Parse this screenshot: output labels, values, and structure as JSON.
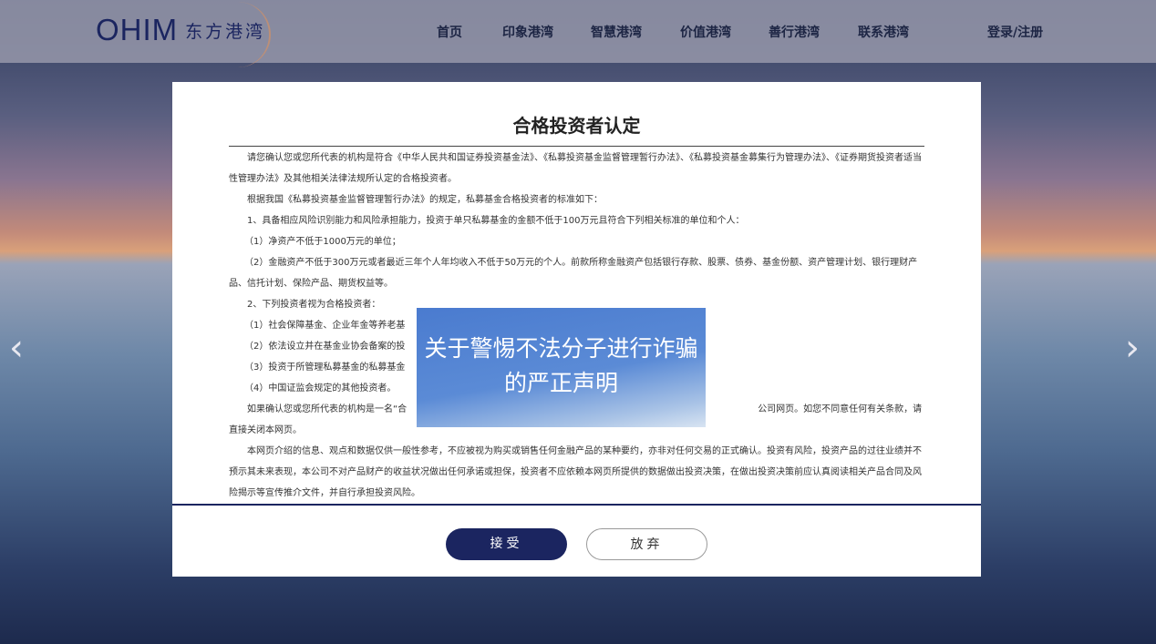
{
  "header": {
    "logo_en": "OHIM",
    "logo_cn": "东方港湾",
    "nav": [
      "首页",
      "印象港湾",
      "智慧港湾",
      "价值港湾",
      "善行港湾",
      "联系港湾"
    ],
    "login": "登录/注册"
  },
  "carousel": {
    "prev": "‹",
    "next": "›"
  },
  "modal": {
    "title": "合格投资者认定",
    "paragraphs": [
      "请您确认您或您所代表的机构是符合《中华人民共和国证券投资基金法》、《私募投资基金监督管理暂行办法》、《私募投资基金募集行为管理办法》、《证券期货投资者适当性管理办法》及其他相关法律法规所认定的合格投资者。",
      "根据我国《私募投资基金监督管理暂行办法》的规定，私募基金合格投资者的标准如下：",
      "1、具备相应风险识别能力和风险承担能力，投资于单只私募基金的金额不低于100万元且符合下列相关标准的单位和个人：",
      "（1）净资产不低于1000万元的单位；",
      "（2）金融资产不低于300万元或者最近三年个人年均收入不低于50万元的个人。前款所称金融资产包括银行存款、股票、债券、基金份额、资产管理计划、银行理财产品、信托计划、保险产品、期货权益等。",
      "2、下列投资者视为合格投资者：",
      "（1）社会保障基金、企业年金等养老基",
      "（2）依法设立并在基金业协会备案的投",
      "（3）投资于所管理私募基金的私募基金",
      "（4）中国证监会规定的其他投资者。",
      "如果确认您或您所代表的机构是一名“合",
      "公司网页。如您不同意任何有关条款，请直接关闭本网页。",
      "本网页介绍的信息、观点和数据仅供一般性参考，不应被视为购买或销售任何金融产品的某种要约，亦非对任何交易的正式确认。投资有风险，投资产品的过往业绩并不预示其未来表现，本公司不对产品财产的收益状况做出任何承诺或担保，投资者不应依赖本网页所提供的数据做出投资决策，在做出投资决策前应认真阅读相关产品合同及风险揭示等宣传推介文件，并自行承担投资风险。"
    ],
    "accept": "接受",
    "reject": "放弃"
  },
  "popup": {
    "text": "关于警惕不法分子进行诈骗的严正声明"
  }
}
